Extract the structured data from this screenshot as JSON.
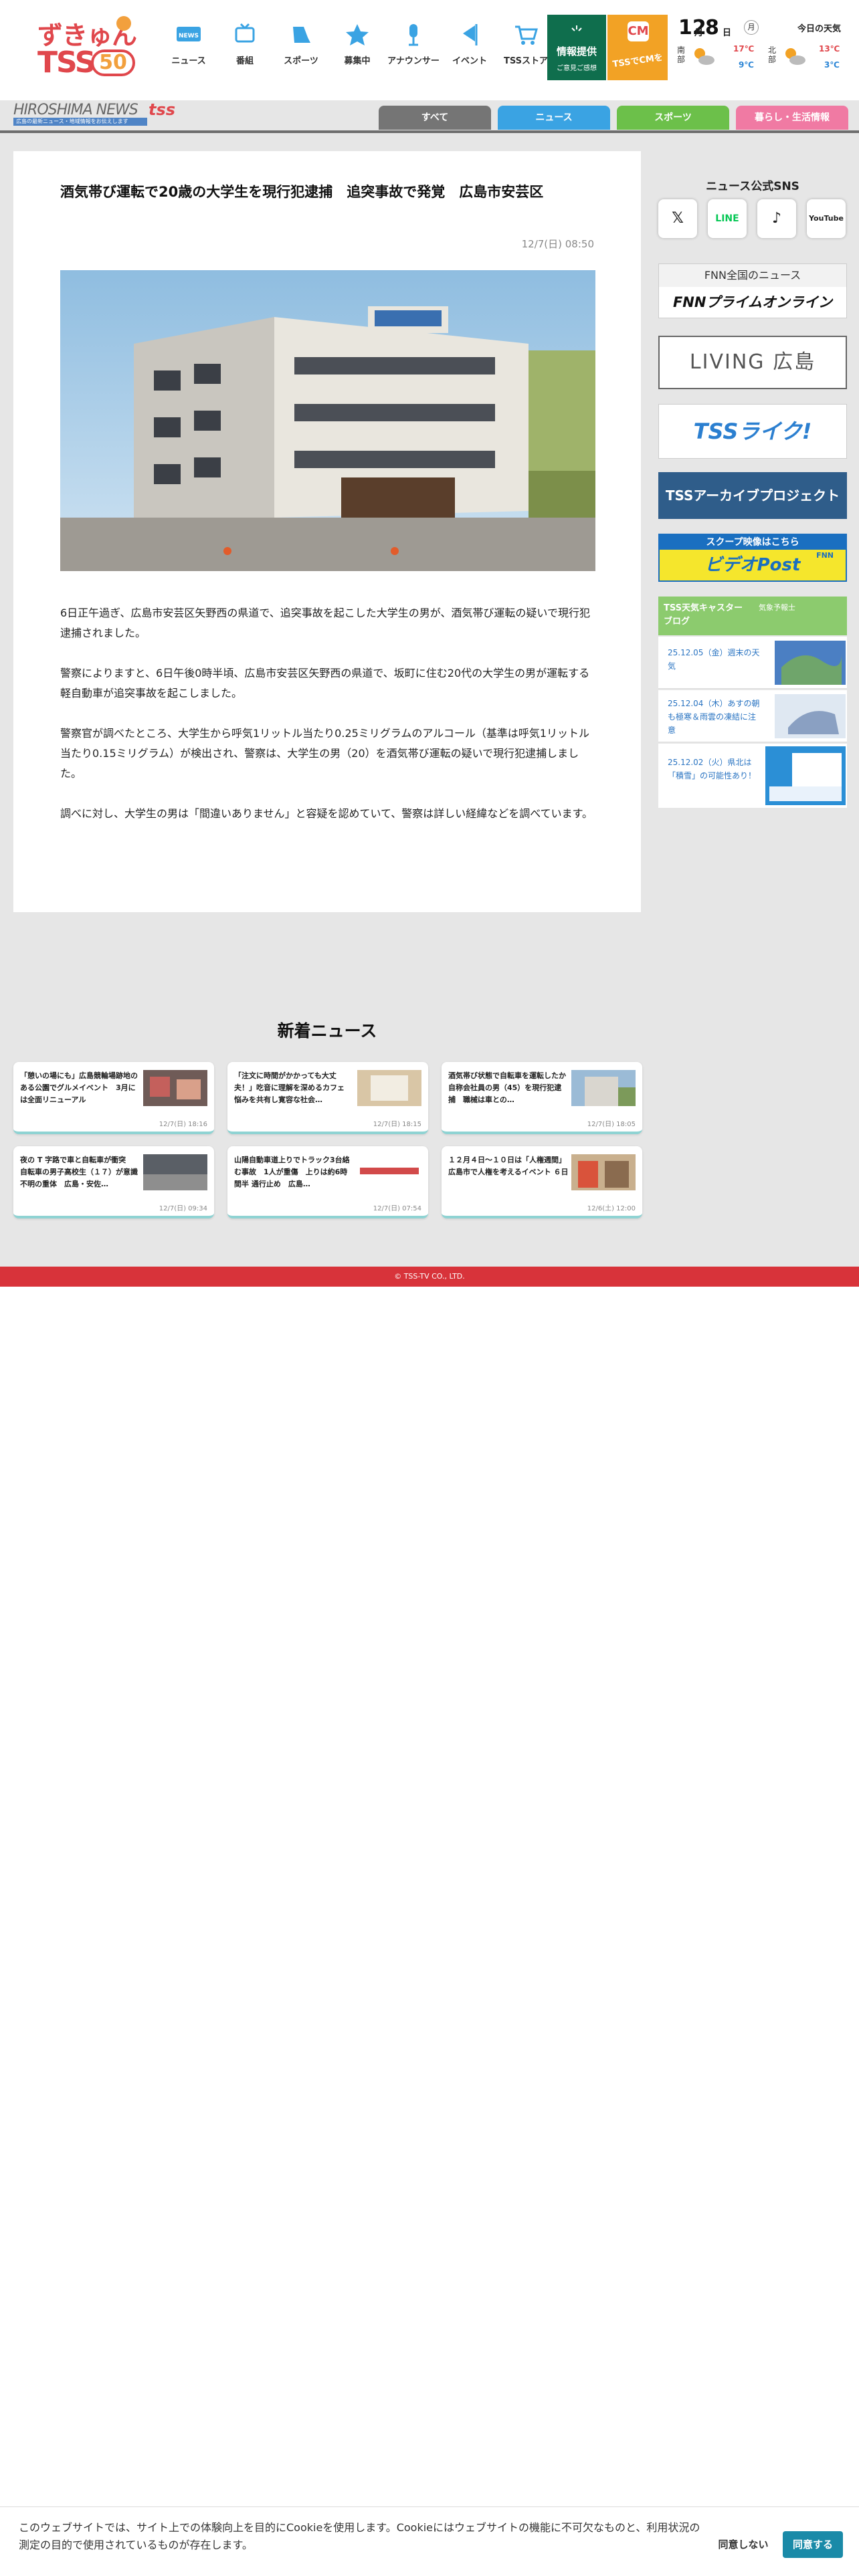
{
  "logo": {
    "line1": "ずきゅん",
    "line2": "TSS",
    "fifty": "50"
  },
  "nav": [
    {
      "label": "ニュース",
      "icon": "news-icon",
      "badge": "NEWS"
    },
    {
      "label": "番組",
      "icon": "tv-icon"
    },
    {
      "label": "スポーツ",
      "icon": "sports-icon"
    },
    {
      "label": "募集中",
      "icon": "star-icon"
    },
    {
      "label": "アナウンサー",
      "icon": "microphone-icon"
    },
    {
      "label": "イベント",
      "icon": "flag-icon"
    },
    {
      "label": "TSSストア",
      "icon": "cart-icon"
    }
  ],
  "info_button": {
    "line1": "情報提供",
    "line2": "ご意見ご感想"
  },
  "cm_button": {
    "line1": "TSSでCMを",
    "badge": "CM"
  },
  "weather": {
    "month": "12",
    "month_unit": "月",
    "day": "8",
    "day_unit": "日",
    "weekday": "月",
    "today_label": "今日の天気",
    "south": {
      "region": "南部",
      "high": "17℃",
      "low": "9℃"
    },
    "north": {
      "region": "北部",
      "high": "13℃",
      "low": "3℃"
    }
  },
  "brand": {
    "name": "HIROSHIMA NEWS",
    "tss": "tss",
    "tagline": "広島の最新ニュース・地域情報をお伝えします"
  },
  "tabs": [
    {
      "label": "すべて",
      "color": "#757575"
    },
    {
      "label": "ニュース",
      "color": "#3aa3e3"
    },
    {
      "label": "スポーツ",
      "color": "#6cc04a"
    },
    {
      "label": "暮らし・生活情報",
      "color": "#f07aa3"
    }
  ],
  "article": {
    "title": "酒気帯び運転で20歳の大学生を現行犯逮捕　追突事故で発覚　広島市安芸区",
    "date": "12/7(日) 08:50",
    "paragraphs": [
      "6日正午過ぎ、広島市安芸区矢野西の県道で、追突事故を起こした大学生の男が、酒気帯び運転の疑いで現行犯逮捕されました。",
      "警察によりますと、6日午後0時半頃、広島市安芸区矢野西の県道で、坂町に住む20代の大学生の男が運転する軽自動車が追突事故を起こしました。",
      "警察官が調べたところ、大学生から呼気1リットル当たり0.25ミリグラムのアルコール（基準は呼気1リットル当たり0.15ミリグラム）が検出され、警察は、大学生の男（20）を酒気帯び運転の疑いで現行犯逮捕しました。",
      "調べに対し、大学生の男は「間違いありません」と容疑を認めていて、警察は詳しい経緯などを調べています。"
    ]
  },
  "sidebar": {
    "sns_title": "ニュース公式SNS",
    "sns": [
      {
        "label": "𝕏",
        "icon": "x-icon"
      },
      {
        "label": "LINE",
        "icon": "line-icon"
      },
      {
        "label": "♪",
        "icon": "tiktok-icon"
      },
      {
        "label": "YouTube",
        "icon": "youtube-icon"
      }
    ],
    "fnn": {
      "top": "FNN全国のニュース",
      "bottom": "FNNプライムオンライン"
    },
    "living": "LIVING 広島",
    "live": "TSSライク!",
    "archive": "TSSアーカイブプロジェクト",
    "scoop": {
      "top": "スクープ映像はこちら",
      "bottom": "ビデオPost",
      "fnn": "FNN"
    },
    "weather_caster": {
      "title": "TSS天気キャスター ブログ",
      "sub": "気象予報士"
    },
    "blog": [
      {
        "date": "25.12.05（金）週末の天気"
      },
      {
        "date": "25.12.04（木）あすの朝も極寒＆雨雲の凍結に注意"
      },
      {
        "date": "25.12.02（火）県北は「積雪」の可能性あり！"
      }
    ]
  },
  "news_section": {
    "title": "新着ニュース",
    "cards": [
      {
        "title": "「憩いの場にも」広島競輪場跡地のある公園でグルメイベント　3月には全面リニューアル",
        "date": "12/7(日) 18:16"
      },
      {
        "title": "「注文に時間がかかっても大丈夫！」吃音に理解を深めるカフェ　悩みを共有し寛容な社会…",
        "date": "12/7(日) 18:15"
      },
      {
        "title": "酒気帯び状態で自転車を運転したか　自称会社員の男（45）を現行犯逮捕　職械は車との…",
        "date": "12/7(日) 18:05"
      },
      {
        "title": "夜の T 字路で車と自転車が衝突　自転車の男子高校生（１７）が意識不明の重体　広島・安佐…",
        "date": "12/7(日) 09:34"
      },
      {
        "title": "山陽自動車道上りでトラック3台絡む事故　1人が重傷　上りは約6時間半 通行止め　広島…",
        "date": "12/7(日) 07:54"
      },
      {
        "title": "１２月４日～１０日は「人権週間」広島市で人権を考えるイベント ６日",
        "date": "12/6(土) 12:00"
      }
    ]
  },
  "footer": {
    "copyright": "© TSS-TV CO., LTD."
  },
  "cookie": {
    "text": "このウェブサイトでは、サイト上での体験向上を目的にCookieを使用します。Cookieにはウェブサイトの機能に不可欠なものと、利用状況の測定の目的で使用されているものが存在します。",
    "deny": "同意しない",
    "accept": "同意する"
  }
}
